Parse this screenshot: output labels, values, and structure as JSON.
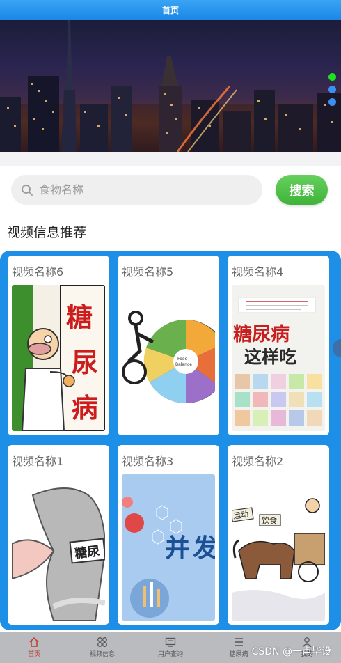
{
  "topbar": {
    "title": "首页"
  },
  "banner": {
    "dot_count": 3,
    "active_dot": 0
  },
  "search": {
    "placeholder": "食物名称",
    "button_label": "搜索"
  },
  "section": {
    "title": "视频信息推荐"
  },
  "cards": [
    {
      "title": "视频名称6",
      "image": "cartoon-doctor-sugar"
    },
    {
      "title": "视频名称5",
      "image": "food-balance-wheel"
    },
    {
      "title": "视频名称4",
      "image": "book-diabetes-eating"
    },
    {
      "title": "视频名称1",
      "image": "cartoon-diabetes-hand"
    },
    {
      "title": "视频名称3",
      "image": "complication-poster"
    },
    {
      "title": "视频名称2",
      "image": "horse-cart-cartoon"
    }
  ],
  "bottom_nav": [
    {
      "label": "首页",
      "icon": "home-icon",
      "active": true
    },
    {
      "label": "视频信息",
      "icon": "grid-icon",
      "active": false
    },
    {
      "label": "用户查询",
      "icon": "tv-icon",
      "active": false
    },
    {
      "label": "糖尿病",
      "icon": "list-icon",
      "active": false
    },
    {
      "label": "我的",
      "icon": "user-icon",
      "active": false
    }
  ],
  "watermark": "CSDN @一点毕设",
  "colors": {
    "accent": "#1e8fe6",
    "search_button": "#4cc244",
    "topbar": "#2a96ee"
  }
}
